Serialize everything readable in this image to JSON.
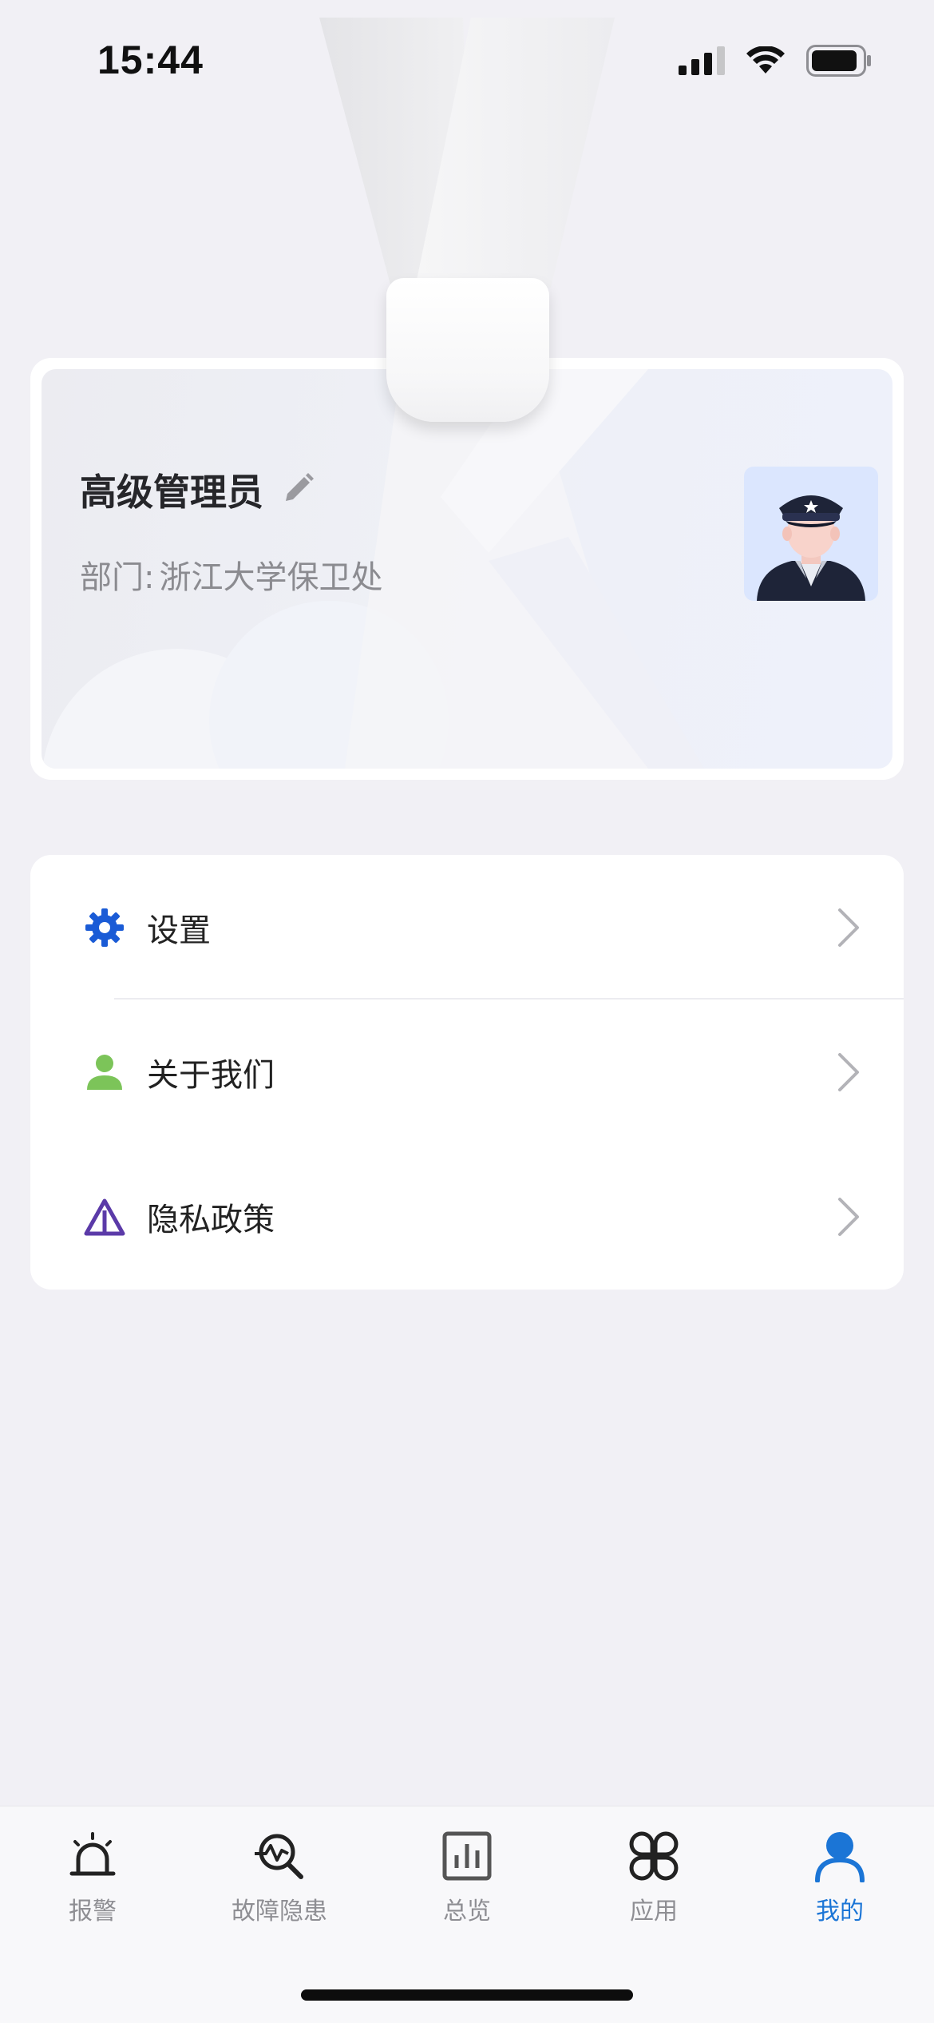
{
  "status_bar": {
    "time": "15:44",
    "icons": [
      "cellular-signal-icon",
      "wifi-icon",
      "battery-icon"
    ]
  },
  "profile": {
    "name": "高级管理员",
    "dept_label": "部门:",
    "dept_value": "浙江大学保卫处",
    "edit_icon": "pencil-icon",
    "avatar": "security-guard-avatar"
  },
  "menu": {
    "items": [
      {
        "label": "设置",
        "icon": "gear-icon",
        "color": "#1a5bd6"
      },
      {
        "label": "关于我们",
        "icon": "person-icon",
        "color": "#7cc459"
      },
      {
        "label": "隐私政策",
        "icon": "warning-triangle-icon",
        "color": "#5b3aa8"
      }
    ]
  },
  "tab_bar": {
    "active_index": 4,
    "active_color": "#1b75d6",
    "inactive_color": "#8e8e93",
    "tabs": [
      {
        "label": "报警",
        "icon": "alarm-siren-icon"
      },
      {
        "label": "故障隐患",
        "icon": "fault-search-icon"
      },
      {
        "label": "总览",
        "icon": "bar-chart-icon"
      },
      {
        "label": "应用",
        "icon": "apps-grid-icon"
      },
      {
        "label": "我的",
        "icon": "profile-person-icon"
      }
    ]
  }
}
